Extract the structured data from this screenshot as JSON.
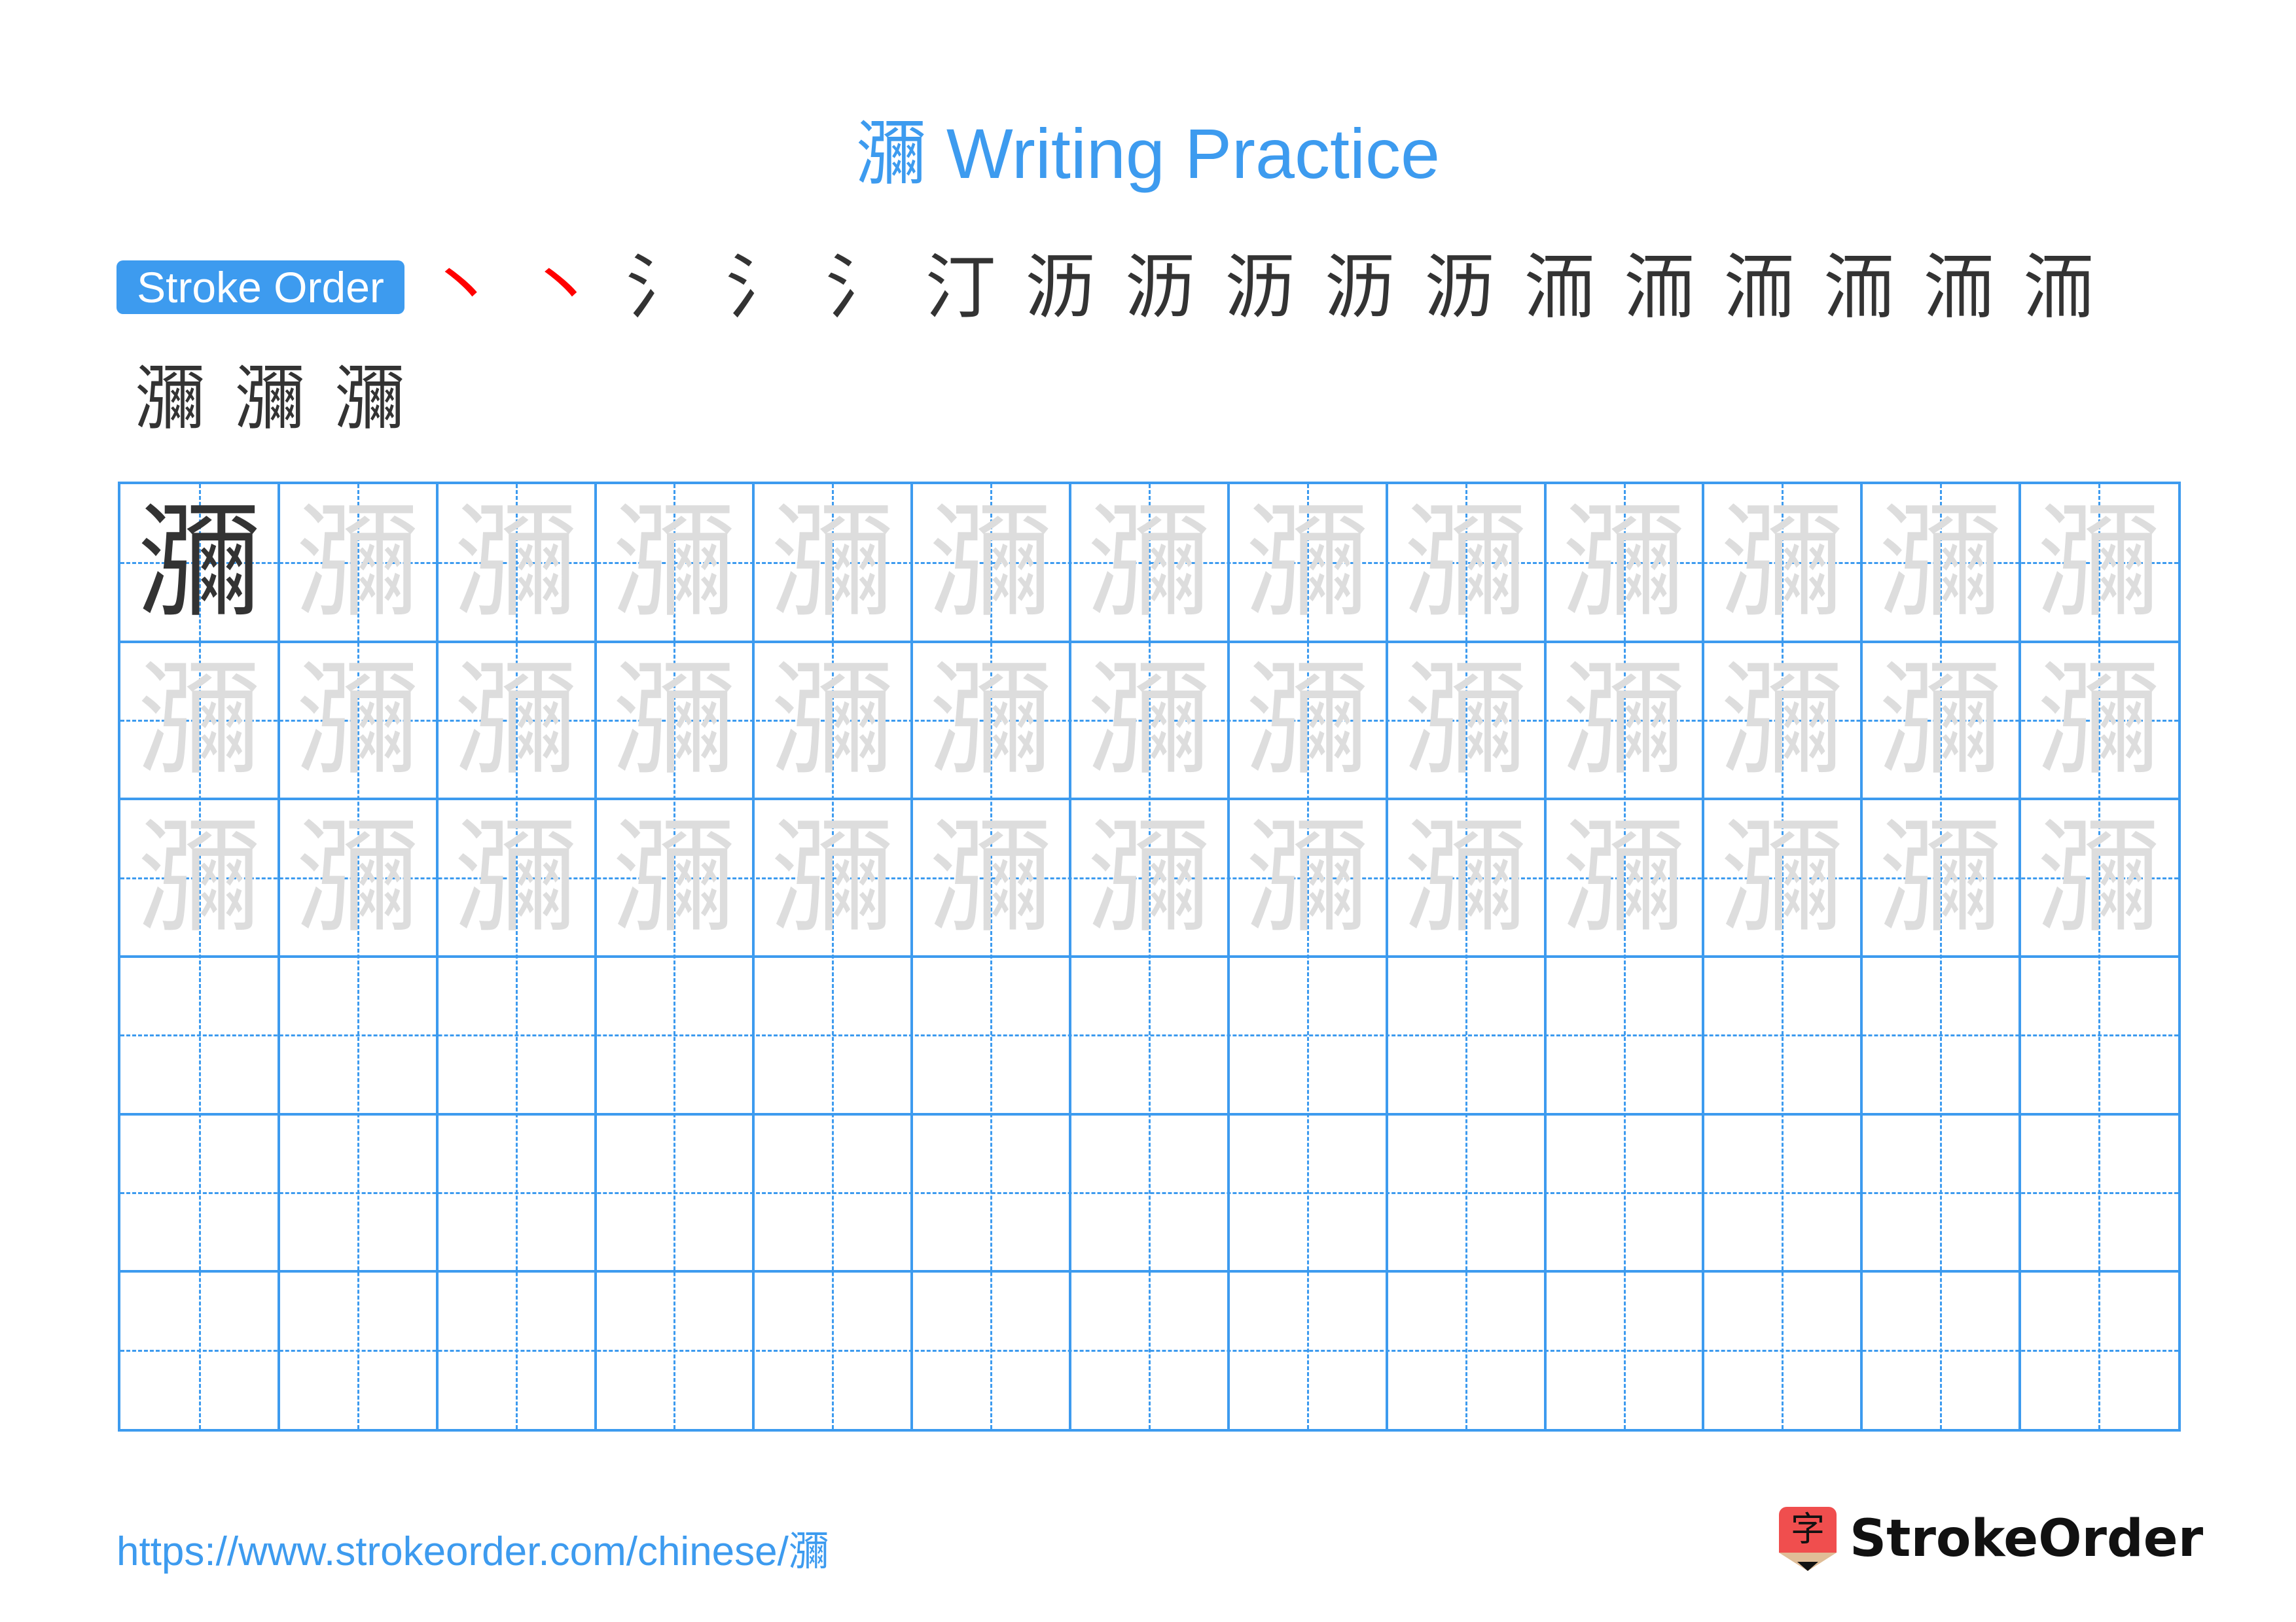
{
  "title": "瀰 Writing Practice",
  "stroke_order": {
    "badge_label": "Stroke Order",
    "character": "瀰",
    "total_strokes": 20,
    "steps": [
      "丶",
      "丶",
      "氵",
      "氵",
      "氵",
      "汀",
      "沥",
      "沥",
      "沥",
      "沥",
      "沥",
      "洏",
      "洏",
      "洏",
      "洏",
      "洏",
      "洏",
      "瀰",
      "瀰",
      "瀰"
    ]
  },
  "grid": {
    "rows": 6,
    "cols": 13,
    "model_character": "瀰",
    "traced_rows": 3,
    "empty_rows": 3,
    "line_color": "#3d9bef",
    "trace_color": "#dddddd",
    "solid_color": "#333333"
  },
  "footer": {
    "url": "https://www.strokeorder.com/chinese/瀰",
    "logo_icon_glyph": "字",
    "logo_text": "StrokeOrder"
  },
  "colors": {
    "accent": "#3d9bef",
    "highlight_stroke": "#ff0000",
    "logo_red": "#f04e4e"
  }
}
